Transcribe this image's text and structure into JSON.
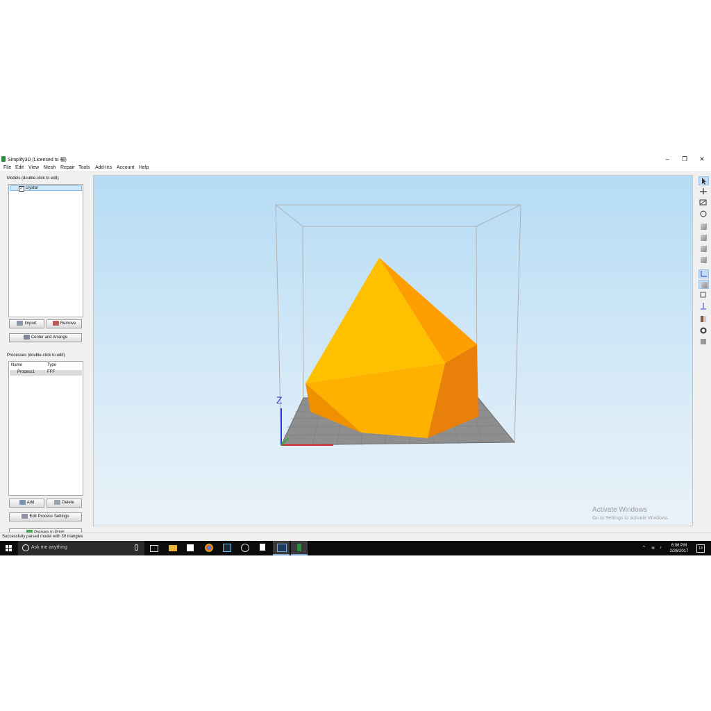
{
  "window": {
    "title": "Simplify3D (Licensed to 楊)",
    "controls": {
      "minimize": "–",
      "restore": "❐",
      "close": "✕"
    }
  },
  "menu": [
    "File",
    "Edit",
    "View",
    "Mesh",
    "Repair",
    "Tools",
    "Add-Ins",
    "Account",
    "Help"
  ],
  "models": {
    "label": "Models (double-click to edit)",
    "items": [
      {
        "name": "crystal",
        "checked": true
      }
    ],
    "import_label": "Import",
    "remove_label": "Remove",
    "center_label": "Center and Arrange"
  },
  "processes": {
    "label": "Processes (double-click to edit)",
    "columns": [
      "Name",
      "Type"
    ],
    "rows": [
      {
        "name": "Process1",
        "type": "FFF"
      }
    ],
    "add_label": "Add",
    "delete_label": "Delete",
    "edit_label": "Edit Process Settings",
    "prepare_label": "Prepare to Print!"
  },
  "viewport": {
    "axis_z_label": "Z",
    "model_color": "#ffa500",
    "activate_title": "Activate Windows",
    "activate_sub": "Go to Settings to activate Windows."
  },
  "toolbar_icons": [
    "select-icon",
    "move-icon",
    "scale-icon",
    "rotate-icon",
    "view-cube-icon",
    "view-cube-icon",
    "view-cube-icon",
    "view-cube-icon",
    "axis-icon",
    "solid-view-icon",
    "wireframe-view-icon",
    "z-axis-icon",
    "section-icon",
    "settings-icon",
    "layers-icon"
  ],
  "status": "Successfully parsed model with 30 triangles",
  "taskbar": {
    "search_placeholder": "Ask me anything",
    "time": "6:06 PM",
    "date": "2/26/2017",
    "notification_count": "13"
  }
}
